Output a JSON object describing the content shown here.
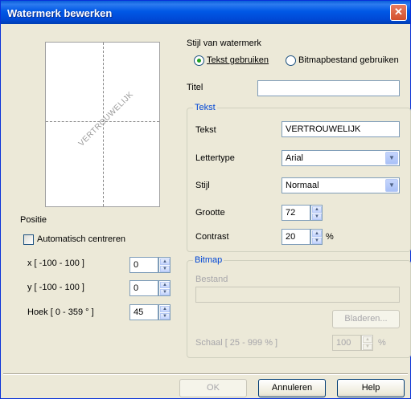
{
  "window": {
    "title": "Watermerk bewerken",
    "close_glyph": "✕"
  },
  "preview": {
    "watermark_text": "VERTROUWELIJK"
  },
  "style": {
    "heading": "Stijl van watermerk",
    "option_text": "Tekst gebruiken",
    "option_bitmap": "Bitmapbestand gebruiken"
  },
  "title_field": {
    "label": "Titel",
    "value": ""
  },
  "text_group": {
    "legend": "Tekst",
    "text_label": "Tekst",
    "text_value": "VERTROUWELIJK",
    "font_label": "Lettertype",
    "font_value": "Arial",
    "style_label": "Stijl",
    "style_value": "Normaal",
    "size_label": "Grootte",
    "size_value": "72",
    "contrast_label": "Contrast",
    "contrast_value": "20",
    "contrast_unit": "%"
  },
  "bitmap_group": {
    "legend": "Bitmap",
    "file_label": "Bestand",
    "file_value": "",
    "browse_label": "Bladeren...",
    "scale_label": "Schaal [ 25 - 999 % ]",
    "scale_value": "100",
    "scale_unit": "%"
  },
  "position": {
    "heading": "Positie",
    "auto_center_label": "Automatisch centreren",
    "x_label": "x [ -100 - 100 ]",
    "x_value": "0",
    "y_label": "y [ -100 - 100 ]",
    "y_value": "0",
    "angle_label": "Hoek [ 0 - 359 ° ]",
    "angle_value": "45"
  },
  "buttons": {
    "ok": "OK",
    "cancel": "Annuleren",
    "help": "Help"
  }
}
